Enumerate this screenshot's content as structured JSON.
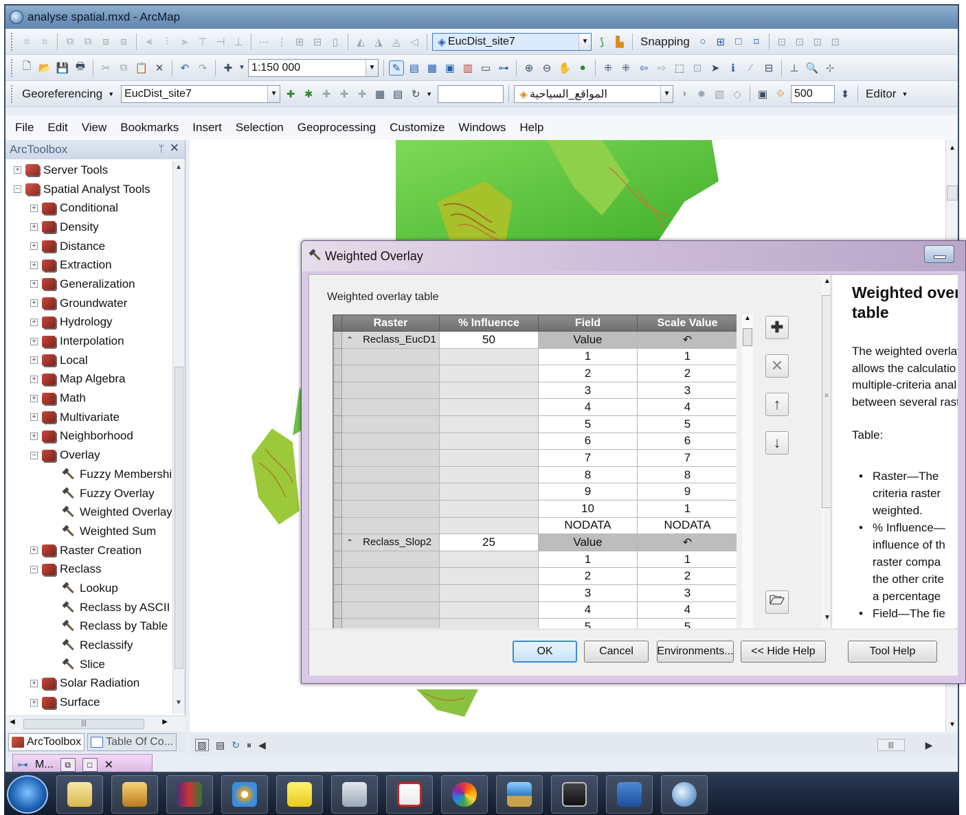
{
  "window": {
    "title": "analyse spatial.mxd - ArcMap"
  },
  "toolbar1": {
    "layer_combo": "EucDist_site7",
    "snapping_label": "Snapping"
  },
  "toolbar2": {
    "scale_combo": "1:150 000"
  },
  "toolbar3": {
    "georef_label": "Georeferencing",
    "georef_layer": "EucDist_site7",
    "layer_combo": "المواقع_السياحية",
    "zoom_value": "500",
    "editor_label": "Editor"
  },
  "menu": [
    "File",
    "Edit",
    "View",
    "Bookmarks",
    "Insert",
    "Selection",
    "Geoprocessing",
    "Customize",
    "Windows",
    "Help"
  ],
  "toolbox": {
    "title": "ArcToolbox",
    "items": [
      {
        "label": "Server Tools",
        "level": 0,
        "kind": "toolbox",
        "expander": "+"
      },
      {
        "label": "Spatial Analyst Tools",
        "level": 0,
        "kind": "toolbox",
        "expander": "−"
      },
      {
        "label": "Conditional",
        "level": 1,
        "kind": "toolset",
        "expander": "+"
      },
      {
        "label": "Density",
        "level": 1,
        "kind": "toolset",
        "expander": "+"
      },
      {
        "label": "Distance",
        "level": 1,
        "kind": "toolset",
        "expander": "+"
      },
      {
        "label": "Extraction",
        "level": 1,
        "kind": "toolset",
        "expander": "+"
      },
      {
        "label": "Generalization",
        "level": 1,
        "kind": "toolset",
        "expander": "+"
      },
      {
        "label": "Groundwater",
        "level": 1,
        "kind": "toolset",
        "expander": "+"
      },
      {
        "label": "Hydrology",
        "level": 1,
        "kind": "toolset",
        "expander": "+"
      },
      {
        "label": "Interpolation",
        "level": 1,
        "kind": "toolset",
        "expander": "+"
      },
      {
        "label": "Local",
        "level": 1,
        "kind": "toolset",
        "expander": "+"
      },
      {
        "label": "Map Algebra",
        "level": 1,
        "kind": "toolset",
        "expander": "+"
      },
      {
        "label": "Math",
        "level": 1,
        "kind": "toolset",
        "expander": "+"
      },
      {
        "label": "Multivariate",
        "level": 1,
        "kind": "toolset",
        "expander": "+"
      },
      {
        "label": "Neighborhood",
        "level": 1,
        "kind": "toolset",
        "expander": "+"
      },
      {
        "label": "Overlay",
        "level": 1,
        "kind": "toolset",
        "expander": "−"
      },
      {
        "label": "Fuzzy Membership",
        "level": 2,
        "kind": "tool",
        "expander": ""
      },
      {
        "label": "Fuzzy Overlay",
        "level": 2,
        "kind": "tool",
        "expander": ""
      },
      {
        "label": "Weighted Overlay",
        "level": 2,
        "kind": "tool",
        "expander": ""
      },
      {
        "label": "Weighted Sum",
        "level": 2,
        "kind": "tool",
        "expander": ""
      },
      {
        "label": "Raster Creation",
        "level": 1,
        "kind": "toolset",
        "expander": "+"
      },
      {
        "label": "Reclass",
        "level": 1,
        "kind": "toolset",
        "expander": "−"
      },
      {
        "label": "Lookup",
        "level": 2,
        "kind": "tool",
        "expander": ""
      },
      {
        "label": "Reclass by ASCII Fi",
        "level": 2,
        "kind": "tool",
        "expander": ""
      },
      {
        "label": "Reclass by Table",
        "level": 2,
        "kind": "tool",
        "expander": ""
      },
      {
        "label": "Reclassify",
        "level": 2,
        "kind": "tool",
        "expander": ""
      },
      {
        "label": "Slice",
        "level": 2,
        "kind": "tool",
        "expander": ""
      },
      {
        "label": "Solar Radiation",
        "level": 1,
        "kind": "toolset",
        "expander": "+"
      },
      {
        "label": "Surface",
        "level": 1,
        "kind": "toolset",
        "expander": "+"
      }
    ]
  },
  "bottom_tabs": {
    "tab1": "ArcToolbox",
    "tab2": "Table Of Co...",
    "mini_label": "M..."
  },
  "dialog": {
    "title": "Weighted Overlay",
    "table_label": "Weighted overlay table",
    "columns": [
      "Raster",
      "% Influence",
      "Field",
      "Scale Value"
    ],
    "groups": [
      {
        "raster": "Reclass_EucD1",
        "influence": "50",
        "field_header": "Value",
        "rows": [
          [
            "1",
            "1"
          ],
          [
            "2",
            "2"
          ],
          [
            "3",
            "3"
          ],
          [
            "4",
            "4"
          ],
          [
            "5",
            "5"
          ],
          [
            "6",
            "6"
          ],
          [
            "7",
            "7"
          ],
          [
            "8",
            "8"
          ],
          [
            "9",
            "9"
          ],
          [
            "10",
            "1"
          ],
          [
            "NODATA",
            "NODATA"
          ]
        ]
      },
      {
        "raster": "Reclass_Slop2",
        "influence": "25",
        "field_header": "Value",
        "rows": [
          [
            "1",
            "1"
          ],
          [
            "2",
            "2"
          ],
          [
            "3",
            "3"
          ],
          [
            "4",
            "4"
          ],
          [
            "5",
            "5"
          ]
        ]
      }
    ],
    "help": {
      "heading_line1": "Weighted overla",
      "heading_line2": "table",
      "para": [
        "The weighted overlay",
        "allows the calculatio",
        "multiple-criteria anal",
        "between several rast"
      ],
      "table_label": "Table:",
      "bullets": [
        [
          "Raster—The",
          "criteria raster",
          "weighted."
        ],
        [
          "% Influence—",
          "influence of th",
          "raster compa",
          "the other crite",
          "a percentage"
        ],
        [
          "Field—The fie"
        ]
      ]
    },
    "buttons": {
      "ok": "OK",
      "cancel": "Cancel",
      "environments": "Environments...",
      "hide_help": "<< Hide Help",
      "tool_help": "Tool Help"
    }
  }
}
